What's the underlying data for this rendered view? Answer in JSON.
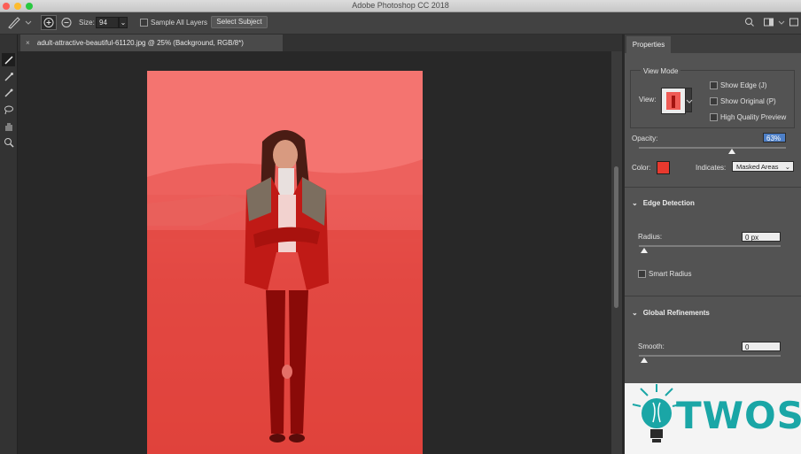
{
  "window": {
    "title": "Adobe Photoshop CC 2018"
  },
  "traffic_lights": {
    "close": "#fc5f57",
    "minimize": "#fdbc2e",
    "zoom": "#28c840"
  },
  "options_bar": {
    "size_label": "Size:",
    "size_value": "94",
    "sample_all_layers": "Sample All Layers",
    "select_subject": "Select Subject"
  },
  "document": {
    "tab_title": "adult-attractive-beautiful-61120.jpg @ 25% (Background, RGB/8*)"
  },
  "overlay": {
    "color": "#ff3b30"
  },
  "properties": {
    "tab": "Properties",
    "view_mode": {
      "heading": "View Mode",
      "view_label": "View:",
      "show_edge": "Show Edge (J)",
      "show_original": "Show Original (P)",
      "high_quality": "High Quality Preview"
    },
    "opacity_label": "Opacity:",
    "opacity_value": "63%",
    "opacity_fraction": 0.63,
    "color_label": "Color:",
    "overlay_color": "#e8392e",
    "indicates_label": "Indicates:",
    "indicates_value": "Masked Areas",
    "edge_detection": {
      "heading": "Edge Detection",
      "radius_label": "Radius:",
      "radius_value": "0 px",
      "smart_radius": "Smart Radius"
    },
    "global_refinements": {
      "heading": "Global Refinements",
      "smooth_label": "Smooth:",
      "smooth_value": "0"
    }
  },
  "watermark": {
    "text": "TWOS"
  }
}
